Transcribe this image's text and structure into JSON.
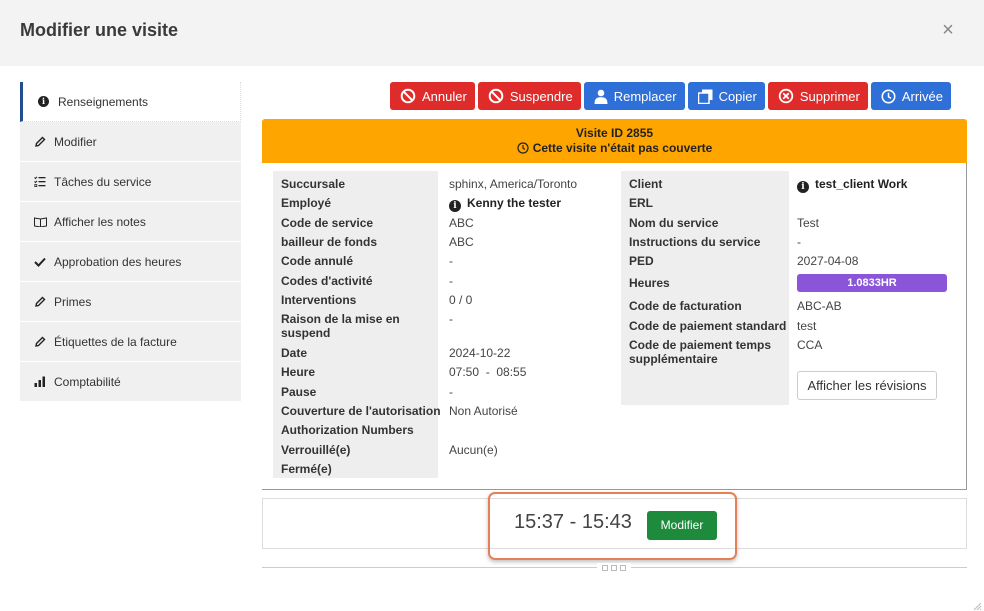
{
  "modal": {
    "title": "Modifier une visite",
    "close": "×"
  },
  "sidebar": {
    "items": [
      {
        "label": "Renseignements",
        "icon": "info-icon",
        "active": true
      },
      {
        "label": "Modifier",
        "icon": "pencil-icon"
      },
      {
        "label": "Tâches du service",
        "icon": "checklist-icon"
      },
      {
        "label": "Afficher les notes",
        "icon": "book-icon"
      },
      {
        "label": "Approbation des heures",
        "icon": "checkmark-icon"
      },
      {
        "label": "Primes",
        "icon": "pencil-icon"
      },
      {
        "label": "Étiquettes de la facture",
        "icon": "pencil-icon"
      },
      {
        "label": "Comptabilité",
        "icon": "bar-chart-icon"
      }
    ]
  },
  "toolbar": {
    "annuler": "Annuler",
    "suspendre": "Suspendre",
    "remplacer": "Remplacer",
    "copier": "Copier",
    "supprimer": "Supprimer",
    "arrivee": "Arrivée"
  },
  "banner": {
    "title": "Visite ID 2855",
    "status": "Cette visite n'était pas couverte",
    "color": "#ffa500"
  },
  "left_details": [
    {
      "label": "Succursale",
      "value": "sphinx, America/Toronto"
    },
    {
      "label": "Employé",
      "value": "Kenny the tester"
    },
    {
      "label": "Code de service",
      "value": "ABC"
    },
    {
      "label": "bailleur de fonds",
      "value": "ABC"
    },
    {
      "label": "Code annulé",
      "value": "-"
    },
    {
      "label": "Codes d'activité",
      "value": "-"
    },
    {
      "label": "Interventions",
      "value": "0 / 0"
    },
    {
      "label": "Raison de la mise en suspend",
      "value": "-"
    },
    {
      "label": "Date",
      "value": "2024-10-22"
    },
    {
      "label": "Heure",
      "value": "07:50  -  08:55"
    },
    {
      "label": "Pause",
      "value": "-"
    },
    {
      "label": "Couverture de l'autorisation",
      "value": "Non Autorisé"
    },
    {
      "label": "Authorization Numbers",
      "value": ""
    },
    {
      "label": "Verrouillé(e)",
      "value": "Aucun(e)"
    },
    {
      "label": "Fermé(e)",
      "value": ""
    }
  ],
  "right_details": [
    {
      "label": "Client",
      "value": "test_client Work"
    },
    {
      "label": "ERL",
      "value": ""
    },
    {
      "label": "Nom du service",
      "value": "Test"
    },
    {
      "label": "Instructions du service",
      "value": "-"
    },
    {
      "label": "PED",
      "value": "2027-04-08"
    },
    {
      "label": "Heures",
      "value": "1.0833HR"
    },
    {
      "label": "Code de facturation",
      "value": "ABC-AB"
    },
    {
      "label": "Code de paiement standard",
      "value": "test"
    },
    {
      "label": "Code de paiement temps supplémentaire",
      "value": "CCA"
    }
  ],
  "revisions_button": "Afficher les révisions",
  "time_block": {
    "range": "15:37 - 15:43",
    "edit_label": "Modifier"
  }
}
